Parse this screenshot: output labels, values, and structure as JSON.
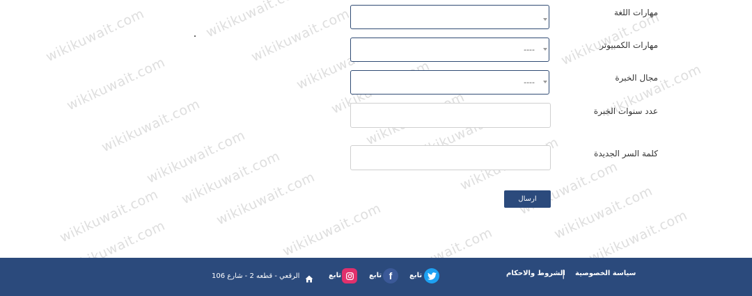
{
  "watermark": "wikikuwait.com",
  "form": {
    "language_skills": {
      "label": "مهارات اللغة",
      "value": ""
    },
    "computer_skills": {
      "label": "مهارات الكمبيوتر",
      "value": "----"
    },
    "experience_field": {
      "label": "مجال الخبرة",
      "value": "----"
    },
    "experience_years": {
      "label": "عدد سنوات الخبرة",
      "value": ""
    },
    "new_password": {
      "label": "كلمة السر الجديدة",
      "value": ""
    },
    "submit_label": "ارسال"
  },
  "footer": {
    "privacy_policy": "سياسة الخصوصية",
    "separator": "|",
    "terms": "الشروط والاحكام",
    "twitter_label": "تابع",
    "facebook_label": "تابع",
    "instagram_label": "تابع",
    "address": "الرقعي - قطعه 2 - شارع 106"
  },
  "colors": {
    "footer_bg": "#2b4a7c",
    "button_bg": "#2b4a7c",
    "select_border": "#2f4a73",
    "twitter": "#1da1f2",
    "facebook": "#3b5998",
    "instagram": "#e1306c"
  },
  "icons": [
    "twitter-icon",
    "facebook-icon",
    "instagram-icon",
    "home-icon",
    "caret-down-icon"
  ]
}
